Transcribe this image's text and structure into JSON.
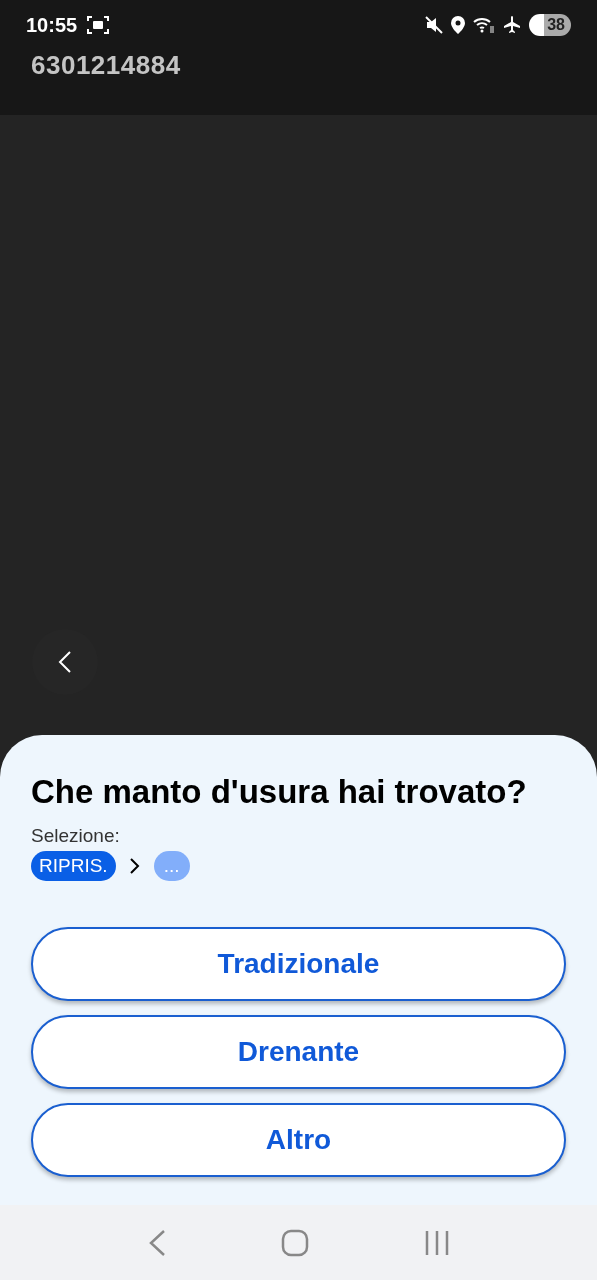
{
  "status_bar": {
    "time": "10:55",
    "battery": "38"
  },
  "header": {
    "title": "6301214884"
  },
  "sheet": {
    "question": "Che manto d'usura hai trovato?",
    "selection_label": "Selezione:",
    "breadcrumb": [
      {
        "label": "RIPRIS.",
        "kind": "done"
      },
      {
        "label": "...",
        "kind": "pending"
      }
    ],
    "options": [
      "Tradizionale",
      "Drenante",
      "Altro"
    ]
  }
}
